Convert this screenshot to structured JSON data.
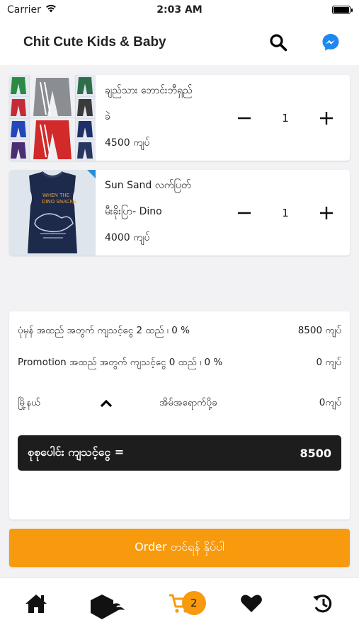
{
  "status_bar": {
    "carrier": "Carrier",
    "time": "2:03 AM",
    "battery_level": 1.0
  },
  "header": {
    "title": "Chit Cute Kids & Baby",
    "search_icon": "search-icon",
    "messenger_icon": "messenger-icon"
  },
  "cart": {
    "items": [
      {
        "name": "ချည်သား ဘောင်းဘီရှည်",
        "variant": "ခဲ",
        "price": "4500 ကျပ်",
        "quantity": "1",
        "minus": "−",
        "plus": "+"
      },
      {
        "name": "Sun Sand လက်ပြတ်",
        "variant": "မီးခိုးပြာ- Dino",
        "price": "4000 ကျပ်",
        "quantity": "1",
        "minus": "−",
        "plus": "+"
      }
    ]
  },
  "summary": {
    "regular_label": "ပုံမှန် အထည် အတွက် ကျသင့်ငွေ 2 ထည် ၊ 0 %",
    "regular_value": "8500 ကျပ်",
    "promo_label": "Promotion အထည် အတွက် ကျသင့်ငွေ 0 ထည် ၊ 0 %",
    "promo_value": "0 ကျပ်",
    "city_label": "မြို့နယ်",
    "delivery_label": "အိမ်အရောက်ပို့ခ",
    "delivery_value": "0ကျပ်",
    "total_label": "စုစုပေါင်း ကျသင့်ငွေ   =",
    "total_value": "8500"
  },
  "order_button": "Order တင်ရန် နှိပ်ပါ",
  "tabs": {
    "cart_count": "2",
    "active_color": "#f79a0e"
  }
}
